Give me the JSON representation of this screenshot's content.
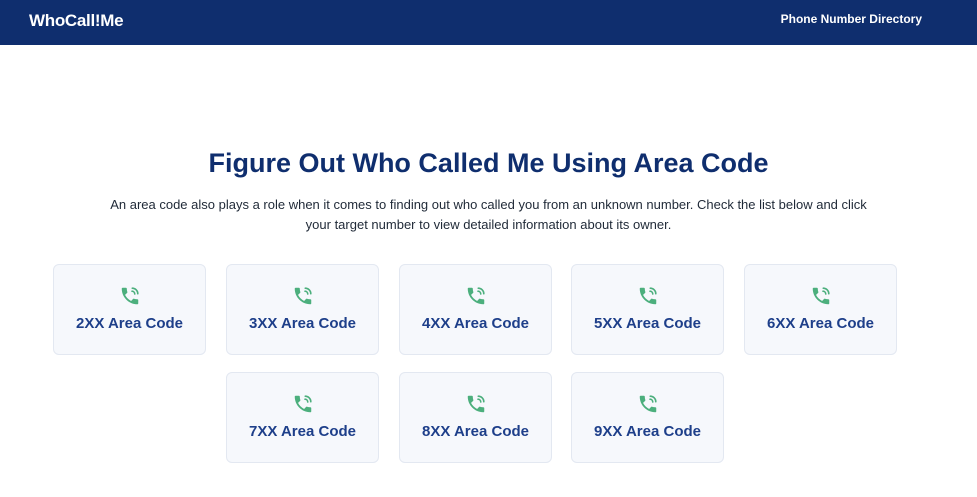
{
  "header": {
    "logo": "WhoCall!Me",
    "nav_link": "Phone Number Directory"
  },
  "hero": {
    "title": "Figure Out Who Called Me Using Area Code",
    "description": "An area code also plays a role when it comes to finding out who called you from an unknown number. Check the list below and click your target number to view detailed information about its owner."
  },
  "area_codes": [
    {
      "label": "2XX Area Code",
      "icon": "phone-ringing-icon"
    },
    {
      "label": "3XX Area Code",
      "icon": "phone-ringing-icon"
    },
    {
      "label": "4XX Area Code",
      "icon": "phone-ringing-icon"
    },
    {
      "label": "5XX Area Code",
      "icon": "phone-ringing-icon"
    },
    {
      "label": "6XX Area Code",
      "icon": "phone-ringing-icon"
    },
    {
      "label": "7XX Area Code",
      "icon": "phone-ringing-icon"
    },
    {
      "label": "8XX Area Code",
      "icon": "phone-ringing-icon"
    },
    {
      "label": "9XX Area Code",
      "icon": "phone-ringing-icon"
    }
  ],
  "colors": {
    "header_bg": "#0f2e6e",
    "title": "#0f2e6e",
    "card_label": "#1e3f8a",
    "icon": "#4caf7d",
    "card_bg": "#f6f8fc"
  }
}
